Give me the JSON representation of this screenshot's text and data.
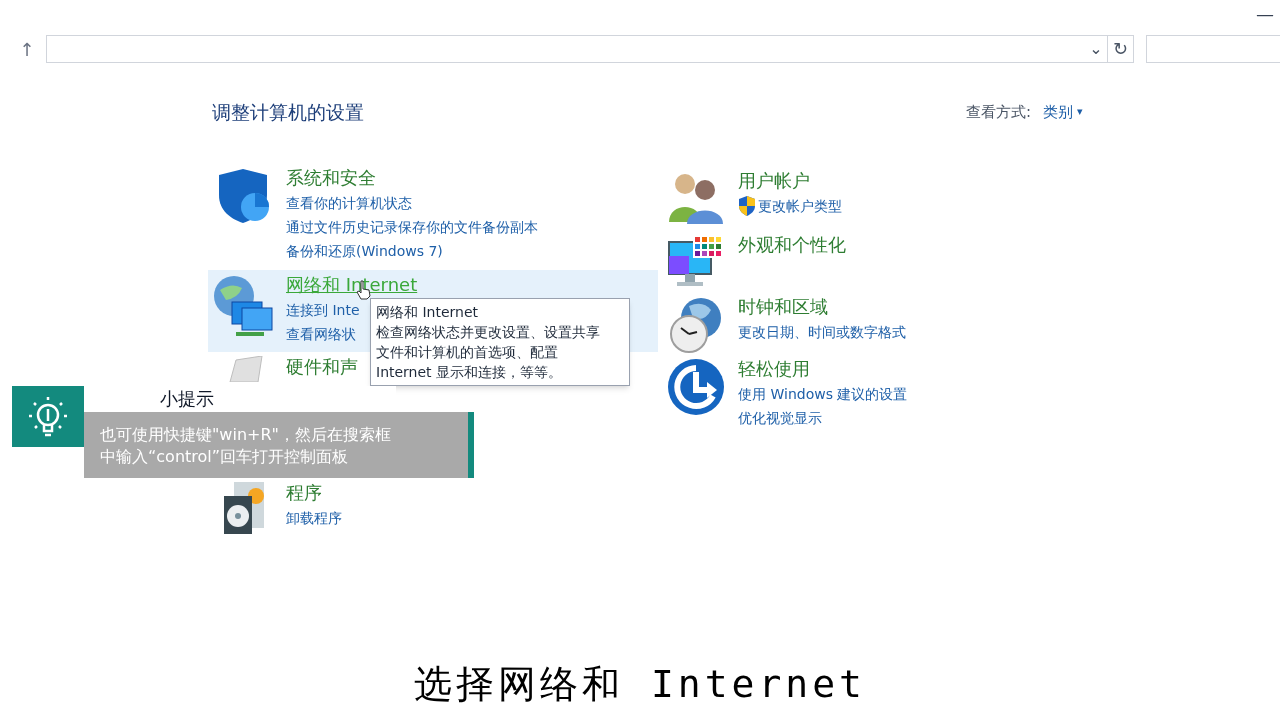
{
  "window": {
    "minimize_symbol": "—"
  },
  "address_bar": {
    "up_symbol": "↑",
    "dropdown_symbol": "⌄",
    "refresh_symbol": "↻"
  },
  "heading": "调整计算机的设置",
  "view_by": {
    "label": "查看方式:",
    "value": "类别",
    "caret": "▾"
  },
  "left_categories": [
    {
      "title": "系统和安全",
      "selected": false,
      "links": [
        "查看你的计算机状态",
        "通过文件历史记录保存你的文件备份副本",
        "备份和还原(Windows 7)"
      ]
    },
    {
      "title": "网络和 Internet",
      "selected": true,
      "links": [
        "连接到 Inte",
        "查看网络状"
      ]
    },
    {
      "title": "硬件和声",
      "selected": false
    },
    {
      "title": "程序",
      "selected": false,
      "links": [
        "卸载程序"
      ]
    }
  ],
  "right_categories": [
    {
      "title": "用户帐户",
      "selected": false,
      "links": [
        {
          "text": "更改帐户类型",
          "shield": true
        }
      ]
    },
    {
      "title": "外观和个性化",
      "selected": false
    },
    {
      "title": "时钟和区域",
      "selected": false,
      "links": [
        {
          "text": "更改日期、时间或数字格式",
          "shield": false
        }
      ]
    },
    {
      "title": "轻松使用",
      "selected": false,
      "links": [
        {
          "text": "使用 Windows 建议的设置",
          "shield": false
        },
        {
          "text": "优化视觉显示",
          "shield": false
        }
      ]
    }
  ],
  "tooltip": {
    "title": "网络和 Internet",
    "lines": [
      "检查网络状态并更改设置、设置共享",
      "文件和计算机的首选项、配置",
      "Internet 显示和连接，等等。"
    ]
  },
  "tip": {
    "title": "小提示",
    "lines": [
      "也可使用快捷键\"win+R\"，然后在搜索框",
      "中输入“control”回车打开控制面板"
    ]
  },
  "subtitle": "选择网络和 Internet"
}
